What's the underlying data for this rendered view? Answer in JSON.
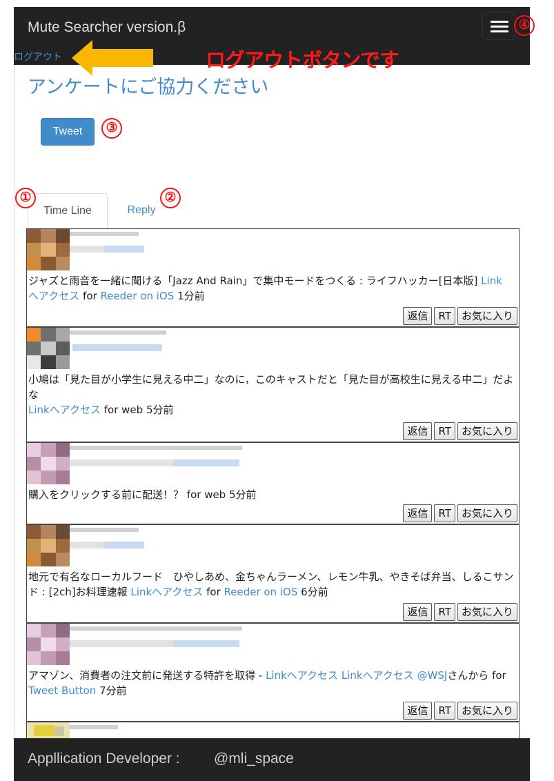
{
  "navbar": {
    "brand": "Mute Searcher version.β",
    "logout": "ログアウト"
  },
  "page": {
    "title": "アンケートにご協力ください",
    "tweet_button": "Tweet"
  },
  "tabs": [
    {
      "label": "Time Line",
      "active": true
    },
    {
      "label": "Reply",
      "active": false
    }
  ],
  "annotations": {
    "logout_note": "ログアウトボタンです",
    "markers": [
      "①",
      "②",
      "③",
      "④"
    ]
  },
  "tweets": [
    {
      "text": "ジャズと雨音を一緒に聞ける「Jazz And Rain」で集中モードをつくる : ライフハッカー[日本版]",
      "link": "Link",
      "text2_link": "へアクセス",
      "for_label": "for",
      "source": "Reeder on iOS",
      "time": "1分前"
    },
    {
      "text": "小鳩は「見た目が小学生に見える中二」なのに，このキャストだと「見た目が高校生に見える中二」だよな",
      "link": "Linkへアクセス",
      "for_label": "for web",
      "time": "5分前"
    },
    {
      "text": "購入をクリックする前に配送！？",
      "for_label": "for web",
      "time": "5分前"
    },
    {
      "text": "地元で有名なローカルフード　ひやしあめ、金ちゃんラーメン、レモン牛乳、やきそば弁当、しるこサンド : [2ch]お料理速報",
      "link": "Linkへアクセス",
      "for_label": "for",
      "source": "Reeder on iOS",
      "time": "6分前"
    },
    {
      "text": "アマゾン、消費者の注文前に発送する特許を取得 -",
      "link": "Linkへアクセス",
      "link2": "Linkへアクセス",
      "mention": "@WSJ",
      "text_tail": "さんから",
      "for_label": "for",
      "source": "Tweet Button",
      "time": "7分前"
    }
  ],
  "actions": {
    "reply": "返信",
    "rt": "RT",
    "fav": "お気に入り"
  },
  "footer": {
    "label": "Appllication Developer :",
    "handle": "@mli_space"
  },
  "colors": {
    "navbar_bg": "#222222",
    "link": "#428bca",
    "annotation": "#ff1a1a",
    "arrow": "#f9b700"
  }
}
